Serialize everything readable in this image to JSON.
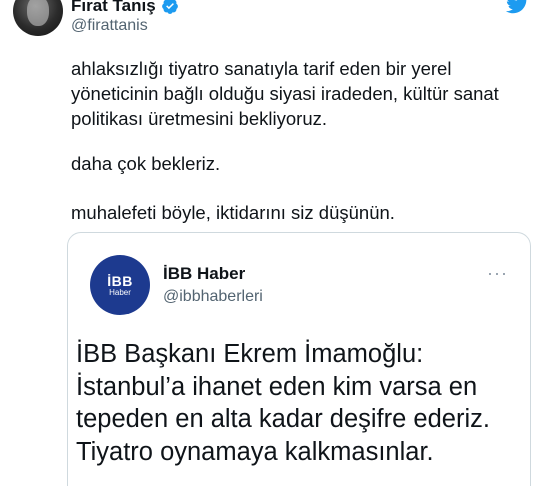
{
  "author": {
    "display_name": "Fırat Tanış",
    "handle": "@firattanis"
  },
  "tweet": {
    "paragraphs": [
      "ahlaksızlığı tiyatro sanatıyla tarif eden bir yerel yöneticinin bağlı olduğu siyasi iradeden, kültür sanat politikası üretmesini bekliyoruz.",
      "daha çok bekleriz.",
      "muhalefeti böyle, iktidarını siz düşünün."
    ]
  },
  "quoted_tweet": {
    "avatar_text": "İBB",
    "avatar_sub": "Haber",
    "display_name": "İBB Haber",
    "handle": "@ibbhaberleri",
    "more_label": "···",
    "text": "İBB Başkanı Ekrem İmamoğlu: İstanbul’a ihanet eden kim varsa en tepeden en alta kadar deşifre ederiz. Tiyatro oynamaya kalkmasınlar."
  },
  "colors": {
    "twitter_blue": "#1d9bf0",
    "ibb_blue": "#1d3a8f",
    "secondary_text": "#536471"
  },
  "icons": {
    "verified": "verified-badge-icon",
    "brand": "twitter-bird-icon",
    "more": "more-dots-icon"
  }
}
